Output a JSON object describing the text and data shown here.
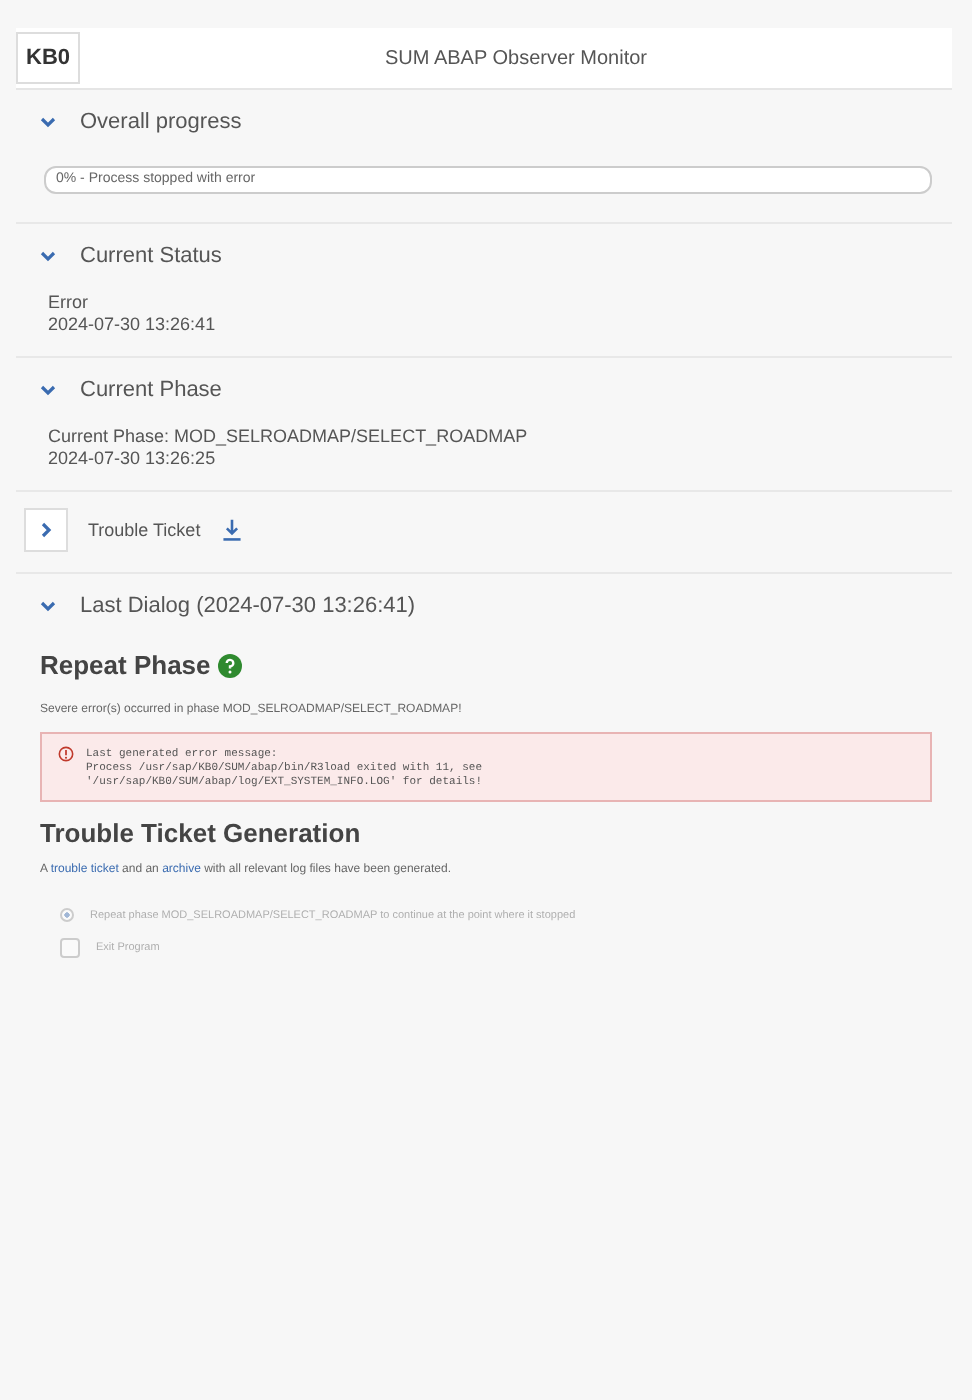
{
  "header": {
    "logo": "KB0",
    "title": "SUM ABAP Observer Monitor"
  },
  "overall_progress": {
    "title": "Overall progress",
    "expanded": true,
    "label": "0% - Process stopped with error",
    "level": 0
  },
  "current_status": {
    "title": "Current Status",
    "expanded": true,
    "lines": [
      "Error",
      "2024-07-30 13:26:41"
    ]
  },
  "current_phase": {
    "title": "Current Phase",
    "expanded": true,
    "lines": [
      "Current Phase: MOD_SELROADMAP/SELECT_ROADMAP",
      "2024-07-30 13:26:25"
    ]
  },
  "trouble_ticket": {
    "title": "Trouble Ticket",
    "expanded": false
  },
  "last_dialog": {
    "title": "Last Dialog  (2024-07-30 13:26:41)",
    "expanded": true,
    "heading": "Repeat Phase",
    "message": "Severe error(s) occurred in phase MOD_SELROADMAP/SELECT_ROADMAP!",
    "error_lines": [
      "Last generated error message:",
      "Process /usr/sap/KB0/SUM/abap/bin/R3load exited with 11, see",
      "'/usr/sap/KB0/SUM/abap/log/EXT_SYSTEM_INFO.LOG' for details!"
    ],
    "ticket_heading": "Trouble Ticket Generation",
    "ticket_text": [
      "A ",
      "trouble ticket",
      " and an ",
      "archive",
      " with all relevant log files have been generated."
    ],
    "options": [
      {
        "kind": "radio",
        "label": "Repeat phase MOD_SELROADMAP/SELECT_ROADMAP to continue at the point where it stopped",
        "selected": true,
        "disabled": true
      },
      {
        "kind": "checkbox",
        "label": "Exit Program",
        "checked": false,
        "disabled": true
      }
    ]
  }
}
